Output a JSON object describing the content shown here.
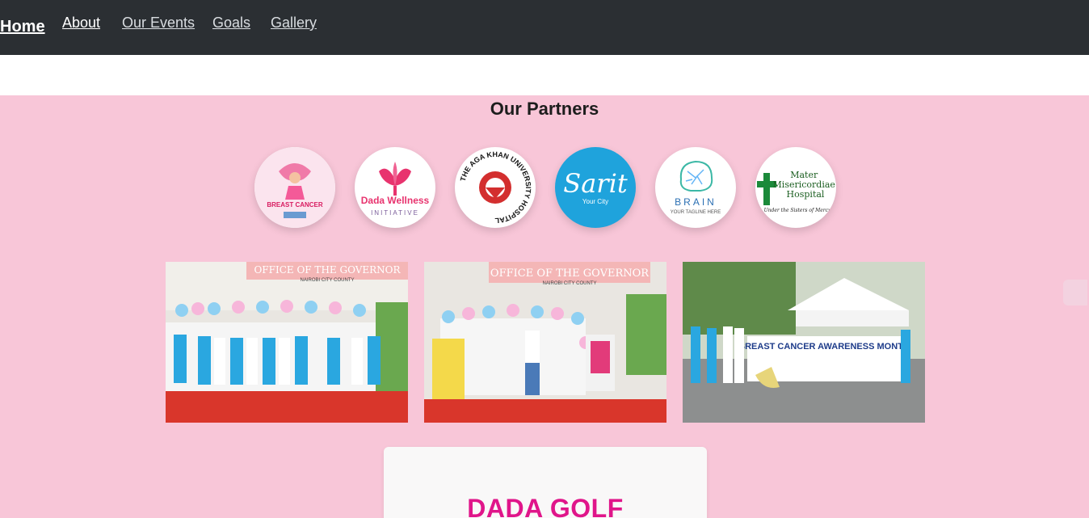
{
  "nav": {
    "items": [
      {
        "label": "Home"
      },
      {
        "label": "About"
      },
      {
        "label": "Our Events"
      },
      {
        "label": "Goals"
      },
      {
        "label": "Gallery"
      }
    ]
  },
  "partners": {
    "title": "Our Partners",
    "logos": [
      {
        "name": "breast-cancer-awareness-logo",
        "text": "BREAST CANCER"
      },
      {
        "name": "dada-wellness-logo",
        "text": "Dada Wellness",
        "sub": "INITIATIVE"
      },
      {
        "name": "aga-khan-logo",
        "text": "THE AGA KHAN UNIVERSITY HOSPITAL"
      },
      {
        "name": "sarit-logo",
        "text": "Sarit",
        "sub": "Your City"
      },
      {
        "name": "brain-logo",
        "text": "BRAIN",
        "sub": "YOUR TAGLINE HERE"
      },
      {
        "name": "mater-hospital-logo",
        "text": "Mater Misericordiae Hospital",
        "sub": "Under the Sisters of Mercy"
      }
    ]
  },
  "gallery": {
    "photos": [
      {
        "caption": "OFFICE OF THE GOVERNOR",
        "sub": "NAIROBI CITY COUNTY"
      },
      {
        "caption": "OFFICE OF THE GOVERNOR",
        "sub": "NAIROBI CITY COUNTY"
      },
      {
        "caption": "BREAST CANCER AWARENESS MONTH"
      }
    ]
  },
  "event_card": {
    "title": "DADA GOLF"
  },
  "colors": {
    "nav_bg": "#2b2f33",
    "section_bg": "#f8c6d8",
    "accent": "#e0158a"
  }
}
